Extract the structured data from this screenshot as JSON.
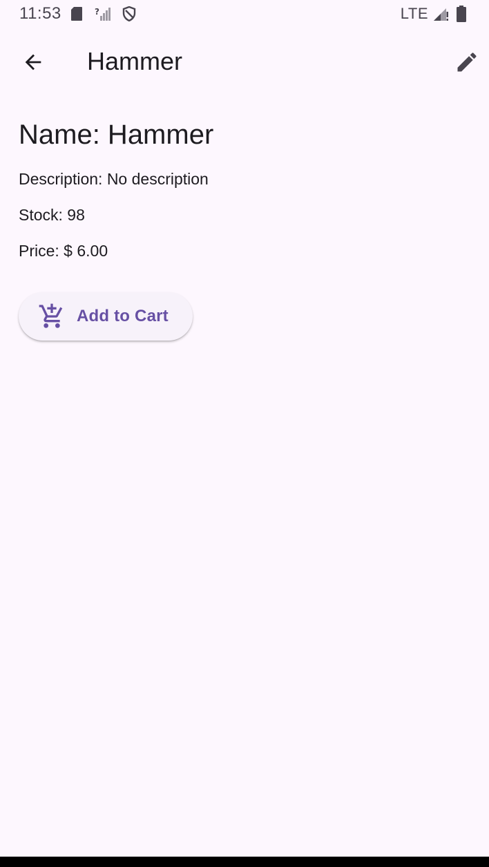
{
  "status_bar": {
    "time": "11:53",
    "left_icons": [
      "sd-card-icon",
      "no-signal-icon",
      "shield-icon"
    ],
    "network": "LTE",
    "right_icons": [
      "cell-signal-icon",
      "battery-icon"
    ]
  },
  "app_bar": {
    "title": "Hammer",
    "back_icon": "arrow-back-icon",
    "edit_icon": "pencil-icon"
  },
  "product": {
    "name_line": "Name: Hammer",
    "description_line": "Description: No description",
    "stock_line": "Stock: 98",
    "price_line": "Price: $ 6.00"
  },
  "actions": {
    "add_to_cart_label": "Add to Cart",
    "add_to_cart_icon": "add-shopping-cart-icon"
  },
  "colors": {
    "background": "#fdf7fe",
    "accent": "#6750a4",
    "text": "#1d1b20",
    "button_surface": "#f7f2fa"
  }
}
